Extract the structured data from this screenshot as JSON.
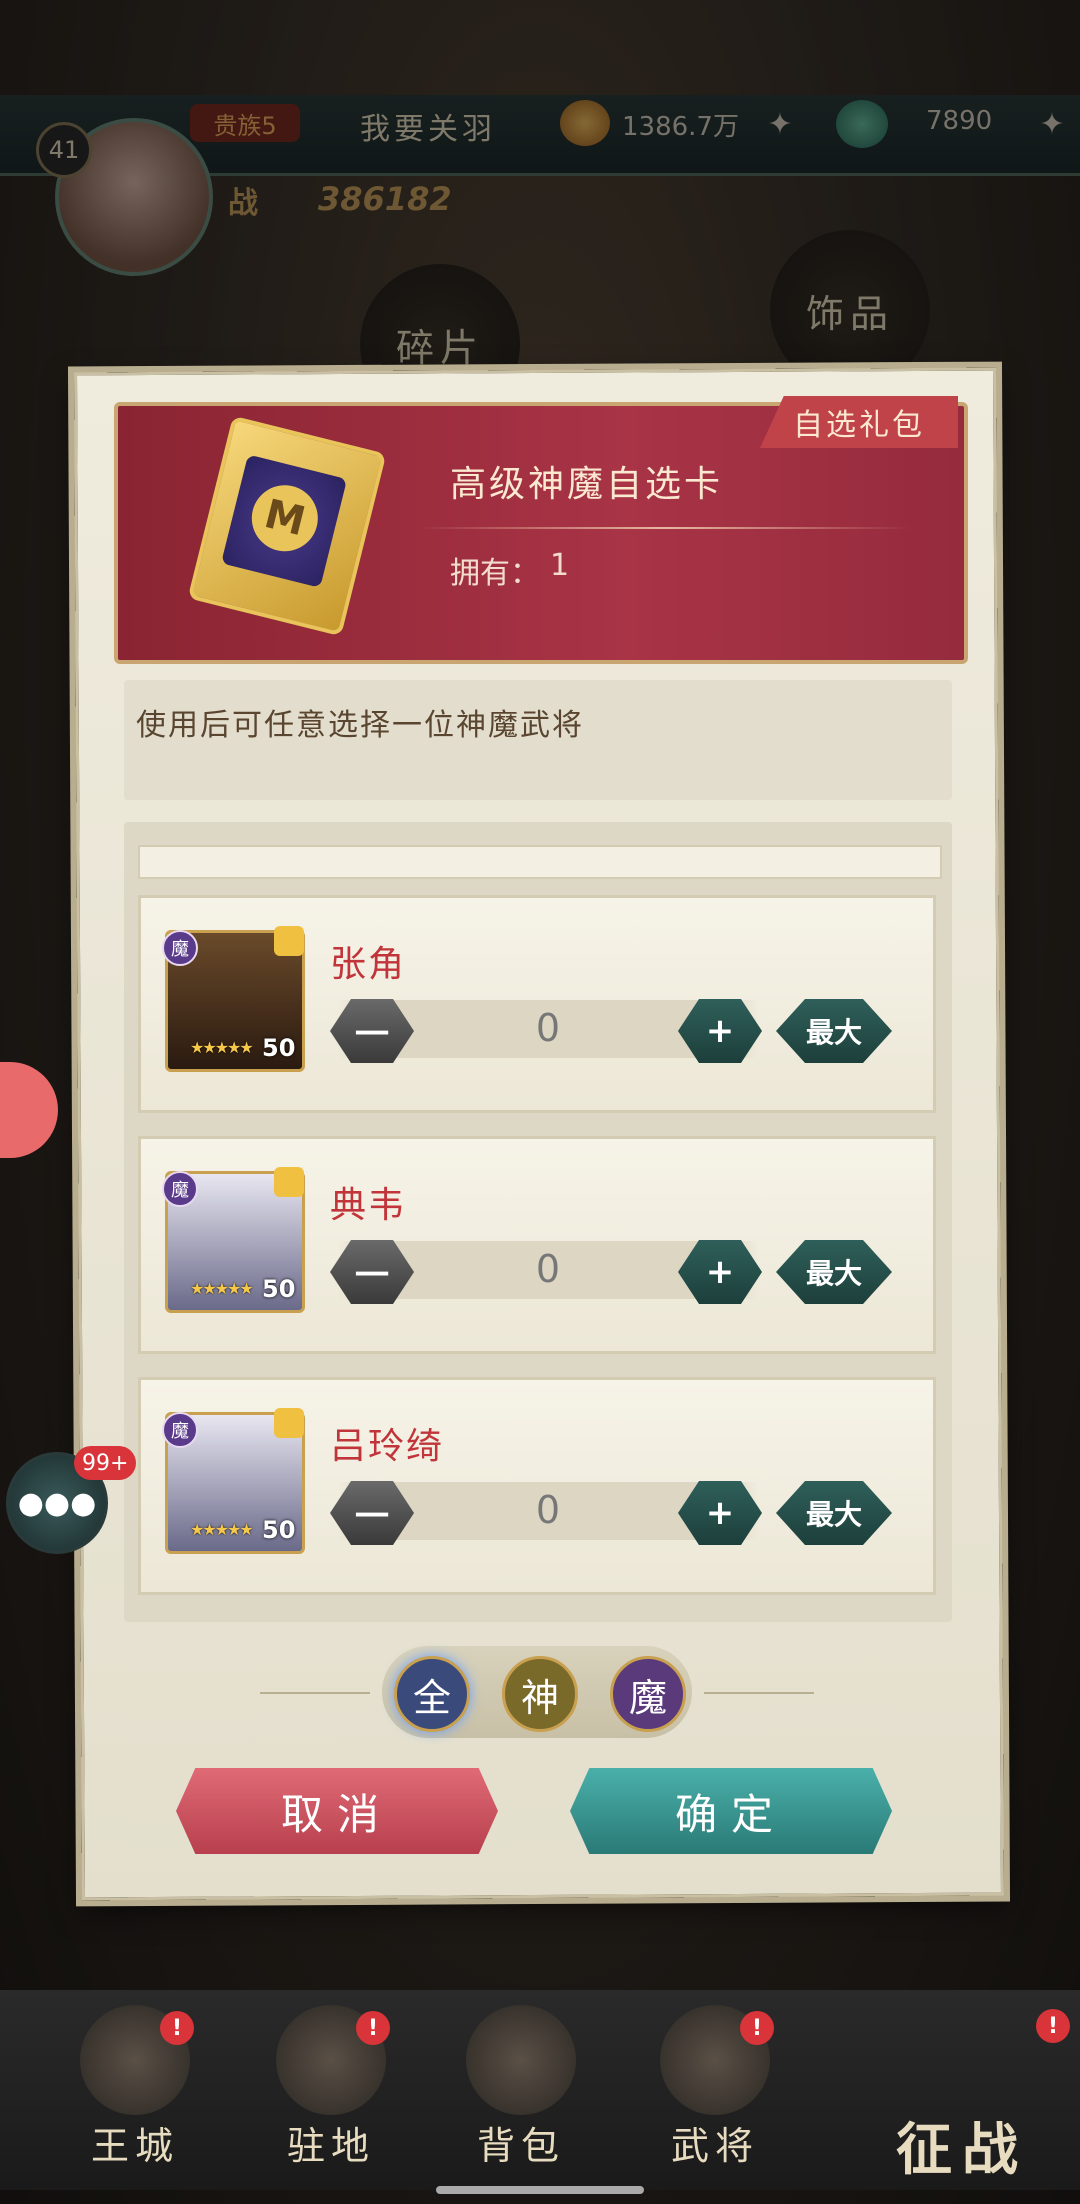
{
  "top_bar": {
    "level": "41",
    "vip": "贵族5",
    "player_name": "我要关羽",
    "gold": "1386.7万",
    "jade": "7890",
    "power_label": "战",
    "power_value": "386182",
    "btn_fragments": "碎片",
    "btn_accessories": "饰品"
  },
  "dialog": {
    "tag": "自选礼包",
    "item_name": "高级神魔自选卡",
    "own_label": "拥有：",
    "own_value": "1",
    "description": "使用后可任意选择一位神魔武将",
    "heroes": [
      {
        "name": "张角",
        "level": "50",
        "faction": "魔",
        "quantity": "0",
        "minus": "一",
        "plus": "+",
        "max": "最大"
      },
      {
        "name": "典韦",
        "level": "50",
        "faction": "魔",
        "quantity": "0",
        "minus": "一",
        "plus": "+",
        "max": "最大"
      },
      {
        "name": "吕玲绮",
        "level": "50",
        "faction": "魔",
        "quantity": "0",
        "minus": "一",
        "plus": "+",
        "max": "最大"
      }
    ],
    "filters": [
      "全",
      "神",
      "魔"
    ],
    "cancel": "取消",
    "confirm": "确定"
  },
  "side": {
    "chat_badge": "99+"
  },
  "bottom_nav": {
    "items": [
      "王城",
      "驻地",
      "背包",
      "武将"
    ],
    "war": "征战"
  },
  "colors": {
    "header_red": "#a83446",
    "hero_name_red": "#c0343a",
    "confirm_teal": "#2a7a76",
    "cancel_pink": "#b8404e"
  }
}
